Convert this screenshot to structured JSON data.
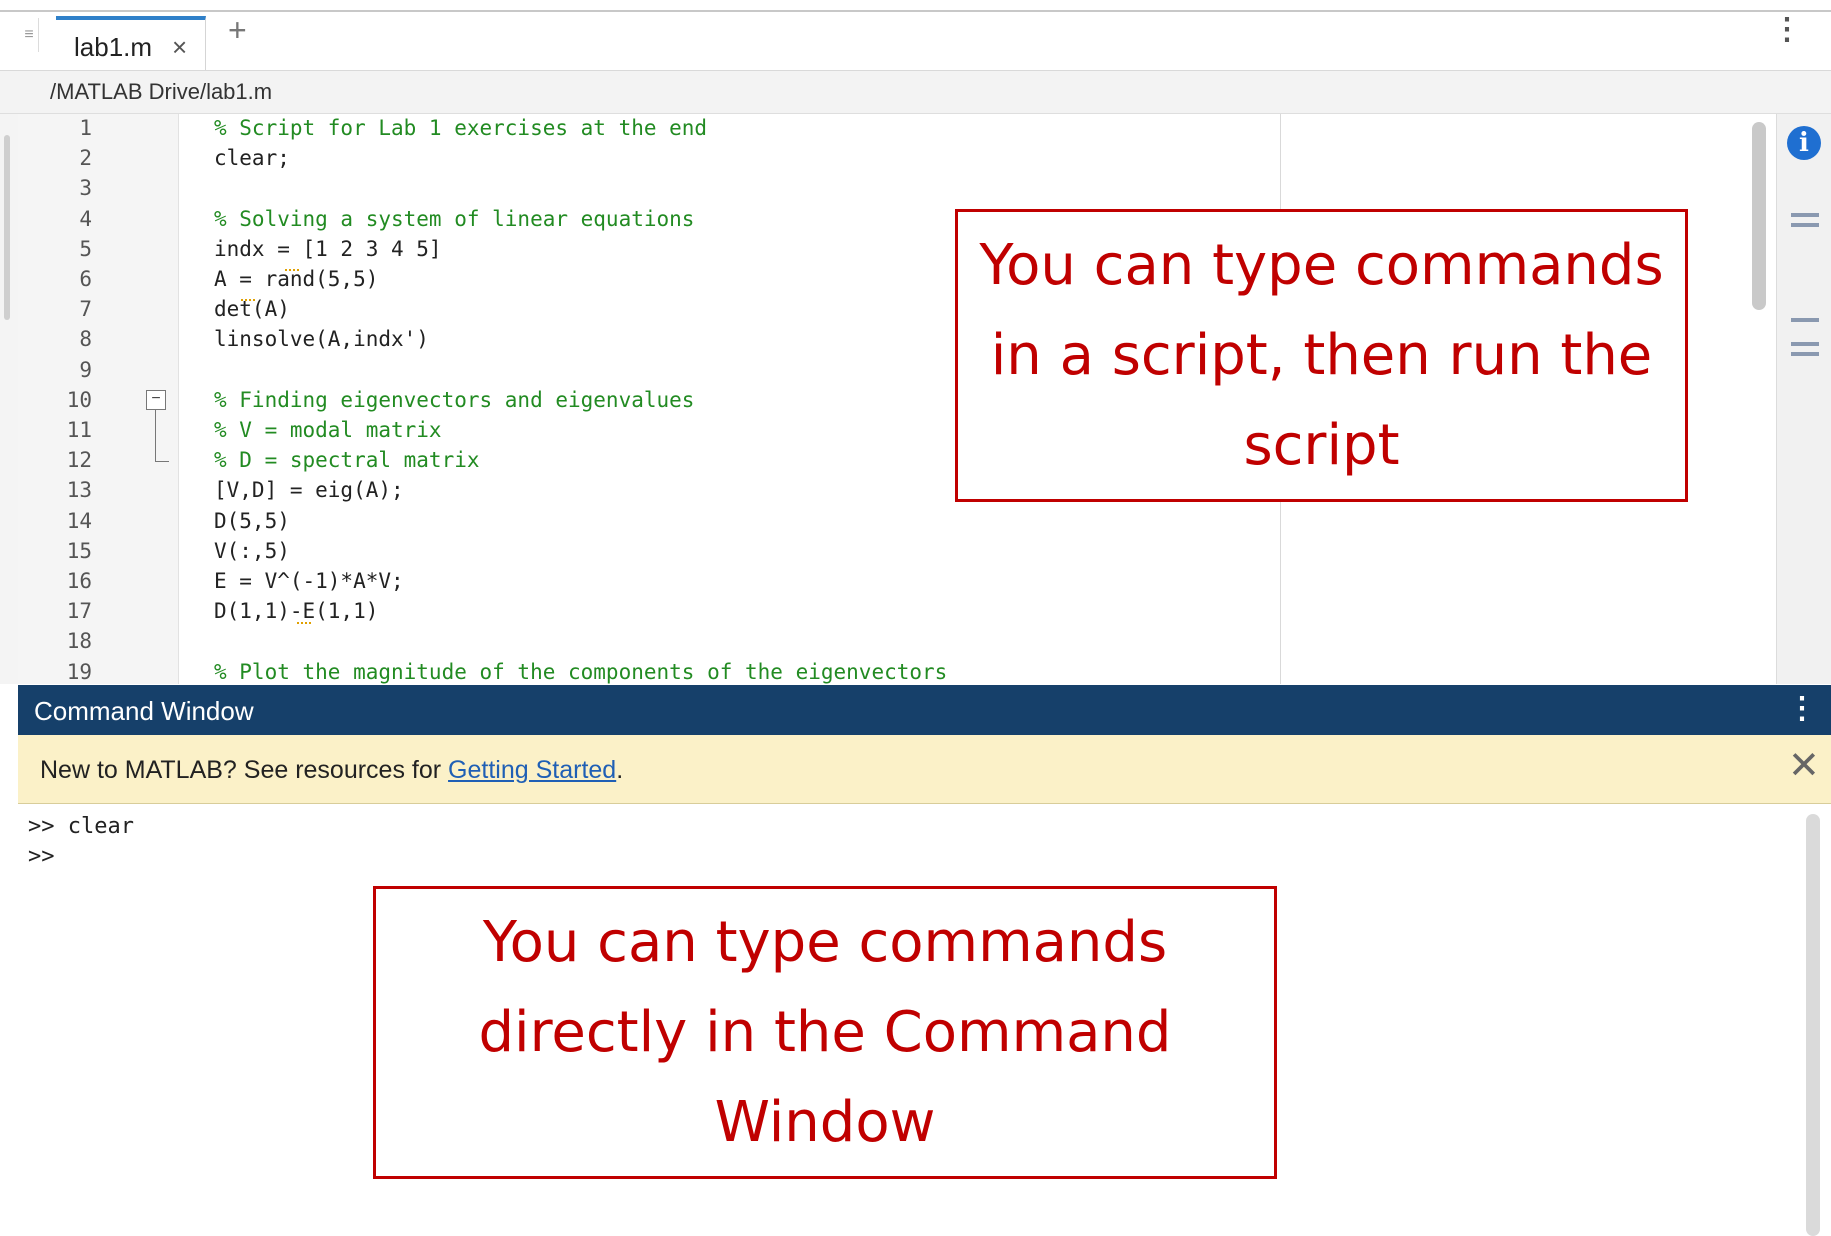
{
  "editor_tabs": [
    {
      "label": "lab1.m",
      "close_glyph": "×"
    }
  ],
  "add_tab_glyph": "+",
  "menu_glyph": "⋮",
  "file_path": "/MATLAB Drive/lab1.m",
  "code_lines": [
    {
      "num": "1",
      "text": "% Script for Lab 1 exercises at the end",
      "comment": true
    },
    {
      "num": "2",
      "text": "clear;",
      "comment": false
    },
    {
      "num": "3",
      "text": "",
      "comment": false
    },
    {
      "num": "4",
      "text": "% Solving a system of linear equations",
      "comment": true
    },
    {
      "num": "5",
      "text": "indx = [1 2 3 4 5]",
      "comment": false
    },
    {
      "num": "6",
      "text": "A = rand(5,5)",
      "comment": false
    },
    {
      "num": "7",
      "text": "det(A)",
      "comment": false
    },
    {
      "num": "8",
      "text": "linsolve(A,indx')",
      "comment": false
    },
    {
      "num": "9",
      "text": "",
      "comment": false
    },
    {
      "num": "10",
      "text": "% Finding eigenvectors and eigenvalues",
      "comment": true
    },
    {
      "num": "11",
      "text": "% V = modal matrix",
      "comment": true
    },
    {
      "num": "12",
      "text": "% D = spectral matrix",
      "comment": true
    },
    {
      "num": "13",
      "text": "[V,D] = eig(A);",
      "comment": false
    },
    {
      "num": "14",
      "text": "D(5,5)",
      "comment": false
    },
    {
      "num": "15",
      "text": "V(:,5)",
      "comment": false
    },
    {
      "num": "16",
      "text": "E = V^(-1)*A*V;",
      "comment": false
    },
    {
      "num": "17",
      "text": "D(1,1)-E(1,1)",
      "comment": false
    },
    {
      "num": "18",
      "text": "",
      "comment": false
    },
    {
      "num": "19",
      "text": "% Plot the magnitude of the components of the eigenvectors",
      "comment": true
    }
  ],
  "fold_glyph": "−",
  "info_glyph": "i",
  "command_window": {
    "title": "Command Window",
    "banner_prefix": "New to MATLAB? See resources for ",
    "banner_link": "Getting Started",
    "banner_suffix": ".",
    "banner_close_glyph": "✕",
    "lines": [
      ">> clear",
      ">>"
    ]
  },
  "callouts": {
    "script": "You can type commands in a script, then run the script",
    "command_window": "You can type commands directly in the Command Window"
  },
  "colors": {
    "command_window_header": "#16406a",
    "banner_background": "#fbf1c8",
    "callout_red": "#c00000",
    "comment_green": "#228b22",
    "active_tab_accent": "#2f80c9"
  }
}
